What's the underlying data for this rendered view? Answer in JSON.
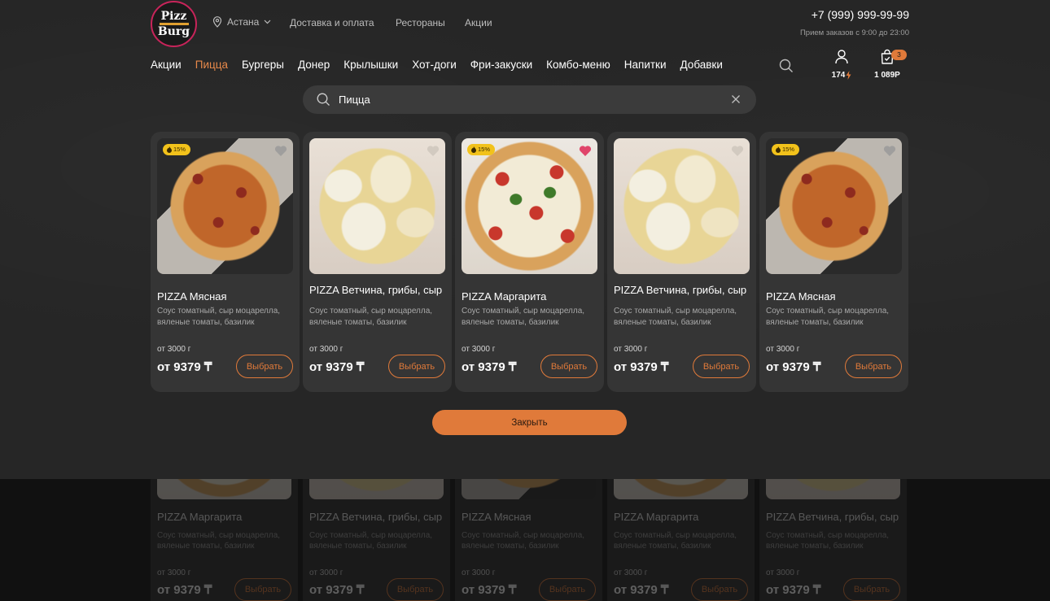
{
  "header": {
    "logo_line1": "Pizz",
    "logo_line2": "Burg",
    "city": "Астана",
    "links": [
      "Доставка и оплата",
      "Рестораны",
      "Акции"
    ],
    "phone": "+7 (999) 999-99-99",
    "hours": "Прием заказов с 9:00 до 23:00"
  },
  "nav": {
    "items": [
      "Акции",
      "Пицца",
      "Бургеры",
      "Донер",
      "Крылышки",
      "Хот-доги",
      "Фри-закуски",
      "Комбо-меню",
      "Напитки",
      "Добавки"
    ],
    "active": "Пицца"
  },
  "user": {
    "points": "174"
  },
  "cart": {
    "count": "3",
    "total": "1 089Р"
  },
  "search": {
    "value": "Пицца"
  },
  "results": [
    {
      "title": "PIZZA Мясная",
      "desc": "Соус томатный, сыр моцарелла, вяленые томаты, базилик",
      "weight": "от 3000 г",
      "price": "от 9379 ₸",
      "button": "Выбрать",
      "badge": "15%",
      "favorite": false,
      "image": "meat"
    },
    {
      "title": "PIZZA Ветчина, грибы, сыр",
      "desc": "Соус томатный, сыр моцарелла, вяленые томаты, базилик",
      "weight": "от 3000 г",
      "price": "от 9379 ₸",
      "button": "Выбрать",
      "badge": "",
      "favorite": false,
      "image": "ham"
    },
    {
      "title": "PIZZA Маргарита",
      "desc": "Соус томатный, сыр моцарелла, вяленые томаты, базилик",
      "weight": "от 3000 г",
      "price": "от 9379 ₸",
      "button": "Выбрать",
      "badge": "15%",
      "favorite": true,
      "image": "marg"
    },
    {
      "title": "PIZZA Ветчина, грибы, сыр",
      "desc": "Соус томатный, сыр моцарелла, вяленые томаты, базилик",
      "weight": "от 3000 г",
      "price": "от 9379 ₸",
      "button": "Выбрать",
      "badge": "",
      "favorite": false,
      "image": "ham"
    },
    {
      "title": "PIZZA Мясная",
      "desc": "Соус томатный, сыр моцарелла, вяленые томаты, базилик",
      "weight": "от 3000 г",
      "price": "от 9379 ₸",
      "button": "Выбрать",
      "badge": "15%",
      "favorite": false,
      "image": "meat"
    }
  ],
  "close_label": "Закрыть",
  "background_cards": [
    {
      "title": "PIZZA Маргарита",
      "desc": "Соус томатный, сыр моцарелла, вяленые томаты, базилик",
      "weight": "от 3000 г",
      "price": "от 9379 ₸",
      "button": "Выбрать"
    },
    {
      "title": "PIZZA Ветчина, грибы, сыр",
      "desc": "Соус томатный, сыр моцарелла, вяленые томаты, базилик",
      "weight": "от 3000 г",
      "price": "от 9379 ₸",
      "button": "Выбрать"
    },
    {
      "title": "PIZZA Мясная",
      "desc": "Соус томатный, сыр моцарелла, вяленые томаты, базилик",
      "weight": "от 3000 г",
      "price": "от 9379 ₸",
      "button": "Выбрать"
    },
    {
      "title": "PIZZA Маргарита",
      "desc": "Соус томатный, сыр моцарелла, вяленые томаты, базилик",
      "weight": "от 3000 г",
      "price": "от 9379 ₸",
      "button": "Выбрать"
    },
    {
      "title": "PIZZA Ветчина, грибы, сыр",
      "desc": "Соус томатный, сыр моцарелла, вяленые томаты, базилик",
      "weight": "от 3000 г",
      "price": "от 9379 ₸",
      "button": "Выбрать"
    }
  ],
  "colors": {
    "accent": "#e07a3a",
    "active_nav": "#e8894a",
    "badge": "#f2c21b",
    "favorite_active": "#e0456a"
  }
}
